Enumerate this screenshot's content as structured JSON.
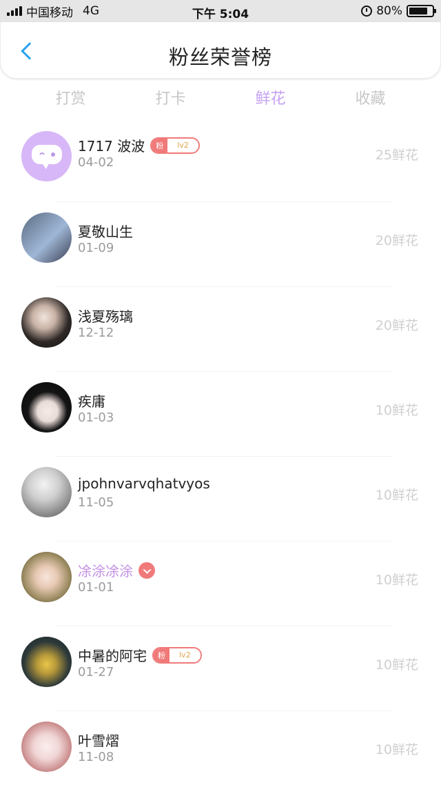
{
  "status_bar": {
    "carrier": "中国移动",
    "network": "4G",
    "time": "下午 5:04",
    "battery": "80%"
  },
  "header": {
    "title": "粉丝荣誉榜"
  },
  "tabs": [
    {
      "label": "打赏",
      "active": false
    },
    {
      "label": "打卡",
      "active": false
    },
    {
      "label": "鲜花",
      "active": true
    },
    {
      "label": "收藏",
      "active": false
    }
  ],
  "fans": [
    {
      "name": "1717 波波",
      "date": "04-02",
      "flowers": "25鲜花",
      "badge": {
        "left": "粉",
        "right": "lv2"
      }
    },
    {
      "name": "夏敬山生",
      "date": "01-09",
      "flowers": "20鲜花"
    },
    {
      "name": "浅夏殇璃",
      "date": "12-12",
      "flowers": "20鲜花"
    },
    {
      "name": "疾庸",
      "date": "01-03",
      "flowers": "10鲜花"
    },
    {
      "name": "jpohnvarvqhatvyos",
      "date": "11-05",
      "flowers": "10鲜花"
    },
    {
      "name": "凃涂凃涂",
      "date": "01-01",
      "flowers": "10鲜花",
      "vip": true
    },
    {
      "name": "中暑的阿宅",
      "date": "01-27",
      "flowers": "10鲜花",
      "badge": {
        "left": "粉",
        "right": "lv2"
      }
    },
    {
      "name": "叶雪熠",
      "date": "11-08",
      "flowers": "10鲜花"
    }
  ]
}
